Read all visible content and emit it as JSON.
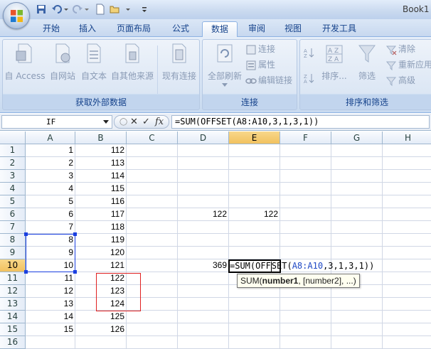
{
  "window": {
    "title": "Book1"
  },
  "tabs": [
    "开始",
    "插入",
    "页面布局",
    "公式",
    "数据",
    "审阅",
    "视图",
    "开发工具"
  ],
  "active_tab": "数据",
  "ribbon": {
    "external_data": {
      "group_label": "获取外部数据",
      "buttons": [
        "自 Access",
        "自网站",
        "自文本",
        "自其他来源",
        "现有连接"
      ]
    },
    "connections": {
      "group_label": "连接",
      "refresh_label": "全部刷新",
      "small": [
        "连接",
        "属性",
        "编辑链接"
      ]
    },
    "sort_filter": {
      "group_label": "排序和筛选",
      "sort_label": "排序...",
      "filter_label": "筛选",
      "small": [
        "清除",
        "重新应用",
        "高级"
      ]
    }
  },
  "formula_bar": {
    "name_box": "IF",
    "fx": "fx",
    "formula": "=SUM(OFFSET(A8:A10,3,1,3,1))"
  },
  "columns": [
    "A",
    "B",
    "C",
    "D",
    "E",
    "F",
    "G",
    "H"
  ],
  "rows": [
    "1",
    "2",
    "3",
    "4",
    "5",
    "6",
    "7",
    "8",
    "9",
    "10",
    "11",
    "12",
    "13",
    "14",
    "15",
    "16"
  ],
  "cells": {
    "A": [
      "1",
      "2",
      "3",
      "4",
      "5",
      "6",
      "7",
      "8",
      "9",
      "10",
      "11",
      "12",
      "13",
      "14",
      "15",
      ""
    ],
    "B": [
      "112",
      "113",
      "114",
      "115",
      "116",
      "117",
      "118",
      "119",
      "120",
      "121",
      "122",
      "123",
      "124",
      "125",
      "126",
      ""
    ],
    "D6": "122",
    "E6": "122",
    "D10": "369"
  },
  "edit": {
    "prefix": "=SUM(OFF",
    "suffix": "SET(",
    "ref": "A8:A10",
    "tail": ",3,1,3,1))"
  },
  "tooltip": {
    "fn": "SUM(",
    "arg1": "number1",
    "rest": ", [number2], ...)"
  }
}
